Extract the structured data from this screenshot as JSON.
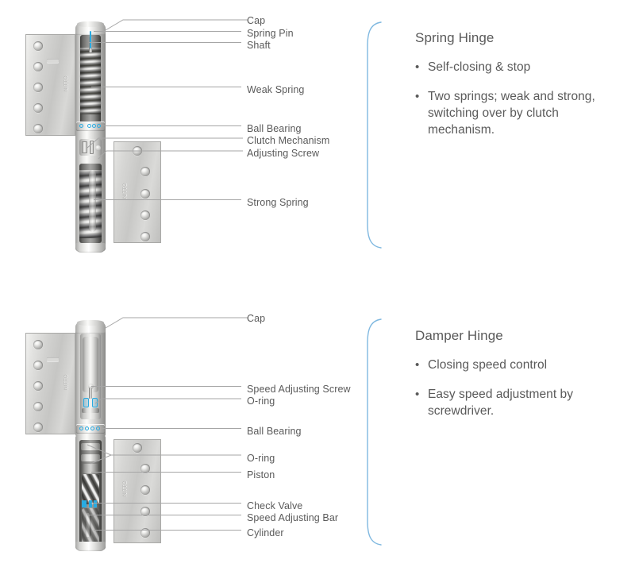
{
  "theme": {
    "accent_cyan": "#29abe2",
    "brace_blue": "#7fb8e0",
    "text_gray": "#5a5a5a",
    "leader_gray": "#a6a6a6",
    "background": "#ffffff"
  },
  "sections": [
    {
      "id": "spring-hinge",
      "panel": {
        "title": "Spring Hinge",
        "bullet_glyph": "•",
        "bullets": [
          "Self-closing & stop",
          "Two springs; weak and strong, switching over by clutch mechanism."
        ]
      },
      "callouts": [
        {
          "label": "Cap"
        },
        {
          "label": "Spring Pin"
        },
        {
          "label": "Shaft"
        },
        {
          "label": "Weak Spring"
        },
        {
          "label": "Ball Bearing"
        },
        {
          "label": "Clutch Mechanism"
        },
        {
          "label": "Adjusting Screw"
        },
        {
          "label": "Strong Spring"
        }
      ],
      "product_marking": "NITTO"
    },
    {
      "id": "damper-hinge",
      "panel": {
        "title": "Damper Hinge",
        "bullet_glyph": "•",
        "bullets": [
          "Closing speed control",
          "Easy speed adjustment by screwdriver."
        ]
      },
      "callouts": [
        {
          "label": "Cap"
        },
        {
          "label": "Speed Adjusting Screw"
        },
        {
          "label": "O-ring"
        },
        {
          "label": "Ball Bearing"
        },
        {
          "label": "O-ring"
        },
        {
          "label": "Piston"
        },
        {
          "label": "Check Valve"
        },
        {
          "label": "Speed Adjusting Bar"
        },
        {
          "label": "Cylinder"
        }
      ],
      "product_marking": "NITTO"
    }
  ]
}
